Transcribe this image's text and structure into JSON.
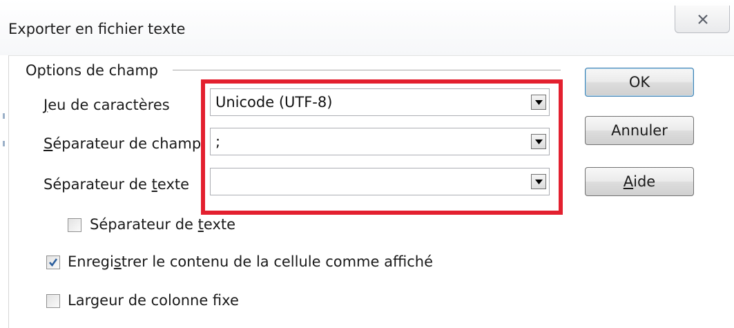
{
  "window": {
    "title": "Exporter en fichier texte",
    "close_icon": "close-icon"
  },
  "field_options": {
    "group_label": "Options de champ",
    "charset": {
      "label_first": "J",
      "label_rest": "eu de caractères",
      "value": "Unicode (UTF-8)"
    },
    "field_separator": {
      "label_first": "S",
      "label_rest": "éparateur de champ",
      "value": ";"
    },
    "text_separator": {
      "label_before": "Séparateur de ",
      "label_accel": "t",
      "label_after": "exte",
      "value": ""
    }
  },
  "checkboxes": [
    {
      "label_before": "Séparateur de ",
      "label_accel": "t",
      "label_after": "exte",
      "checked": false
    },
    {
      "label_before": "Enregi",
      "label_accel": "s",
      "label_after": "trer le contenu de la cellule comme affiché",
      "checked": true
    },
    {
      "label_before": "Largeur de colonne f",
      "label_accel": "i",
      "label_after": "xe",
      "checked": false
    }
  ],
  "buttons": {
    "ok": "OK",
    "cancel": "Annuler",
    "help_accel": "A",
    "help_rest": "ide"
  },
  "colors": {
    "highlight": "#e3202f",
    "check": "#2c5f9e"
  }
}
